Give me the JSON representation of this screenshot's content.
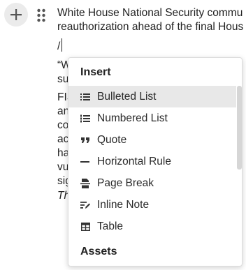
{
  "editor": {
    "paragraph1": [
      "White House National Security commu",
      "reauthorization ahead of the final Hous"
    ],
    "slash_text": "/",
    "paragraph2": [
      "“W",
      "su"
    ],
    "paragraph3": [
      "FIS",
      "an",
      "co",
      "ac",
      "ha",
      "vu",
      "sig"
    ],
    "paragraph4": "Th"
  },
  "menu": {
    "insert_heading": "Insert",
    "items": [
      {
        "label": "Bulleted List",
        "icon": "bulleted-list-icon",
        "selected": true
      },
      {
        "label": "Numbered List",
        "icon": "numbered-list-icon"
      },
      {
        "label": "Quote",
        "icon": "quote-icon"
      },
      {
        "label": "Horizontal Rule",
        "icon": "horizontal-rule-icon"
      },
      {
        "label": "Page Break",
        "icon": "page-break-icon"
      },
      {
        "label": "Inline Note",
        "icon": "inline-note-icon"
      },
      {
        "label": "Table",
        "icon": "table-icon"
      }
    ],
    "assets_heading": "Assets"
  }
}
